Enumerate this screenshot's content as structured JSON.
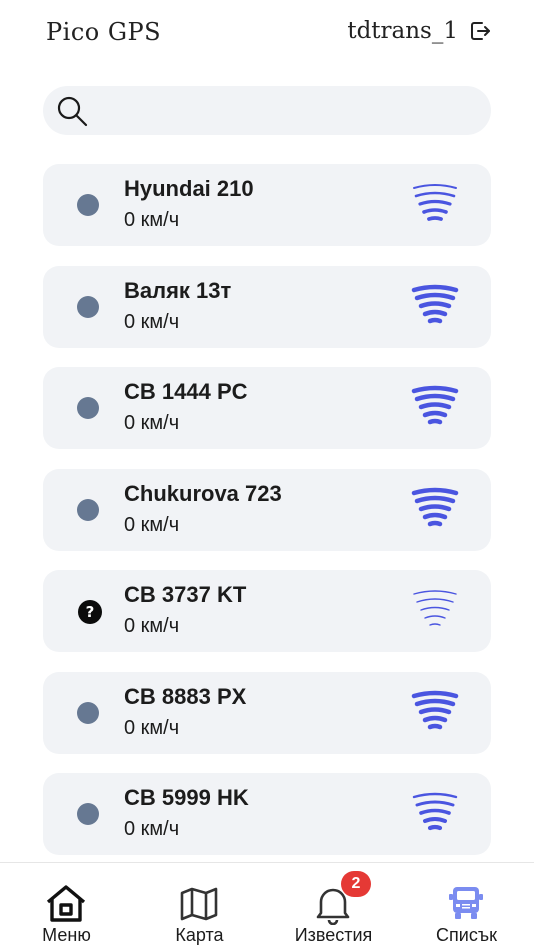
{
  "header": {
    "title": "Pico GPS",
    "username": "tdtrans_1"
  },
  "search": {
    "value": "",
    "placeholder": ""
  },
  "vehicles": [
    {
      "name": "Hyundai 210",
      "speed": "0 км/ч",
      "status": "dot"
    },
    {
      "name": "Валяк 13т",
      "speed": "0 км/ч",
      "status": "dot"
    },
    {
      "name": "CB 1444 PC",
      "speed": "0 км/ч",
      "status": "dot"
    },
    {
      "name": "Chukurova 723",
      "speed": "0 км/ч",
      "status": "dot"
    },
    {
      "name": "CB 3737 KT",
      "speed": "0 км/ч",
      "status": "unknown"
    },
    {
      "name": "CB 8883 PX",
      "speed": "0 км/ч",
      "status": "dot"
    },
    {
      "name": "CB 5999 HK",
      "speed": "0 км/ч",
      "status": "dot"
    }
  ],
  "unknown_glyph": "?",
  "tabs": [
    {
      "label": "Меню",
      "icon": "home-icon"
    },
    {
      "label": "Карта",
      "icon": "map-icon"
    },
    {
      "label": "Известия",
      "icon": "bell-icon",
      "badge": "2"
    },
    {
      "label": "Списък",
      "icon": "truck-icon"
    }
  ],
  "colors": {
    "signal": "#4a55e0",
    "dot": "#667892",
    "card": "#f1f3f6",
    "badge": "#e53935",
    "truck": "#7b8cf0"
  }
}
